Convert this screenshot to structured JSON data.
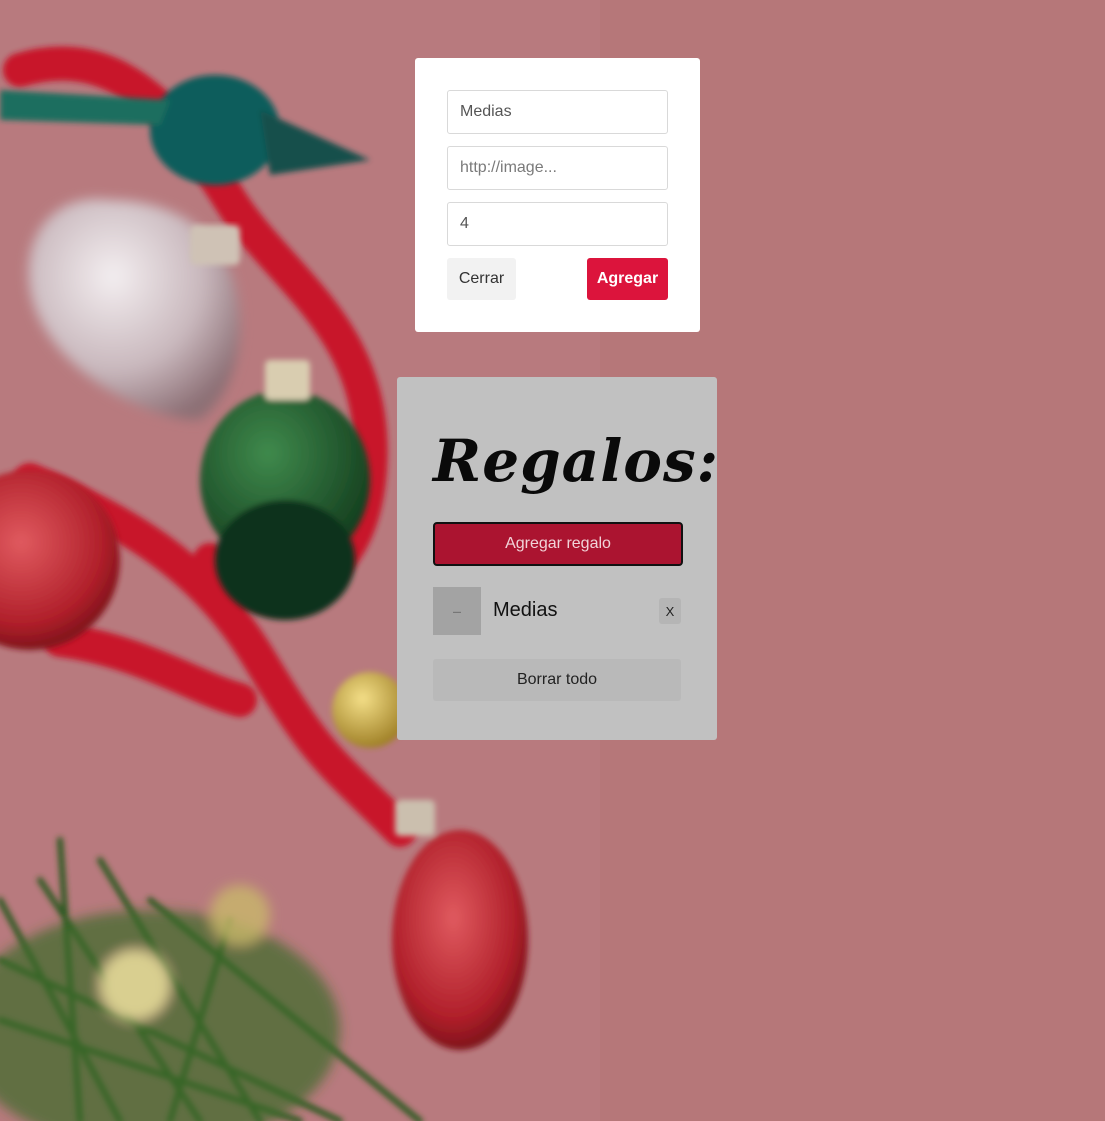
{
  "form": {
    "name_value": "Medias",
    "image_placeholder": "http://image...",
    "quantity_value": "4",
    "close_label": "Cerrar",
    "add_label": "Agregar"
  },
  "gifts_panel": {
    "title": "Regalos:",
    "add_gift_label": "Agregar regalo",
    "items": [
      {
        "name": "Medias",
        "remove_label": "X"
      }
    ],
    "clear_all_label": "Borrar todo"
  },
  "colors": {
    "accent": "#dc143c",
    "add_gift_button": "#ab1430",
    "panel": "#c1c1c1",
    "background": "#b87a7e"
  }
}
